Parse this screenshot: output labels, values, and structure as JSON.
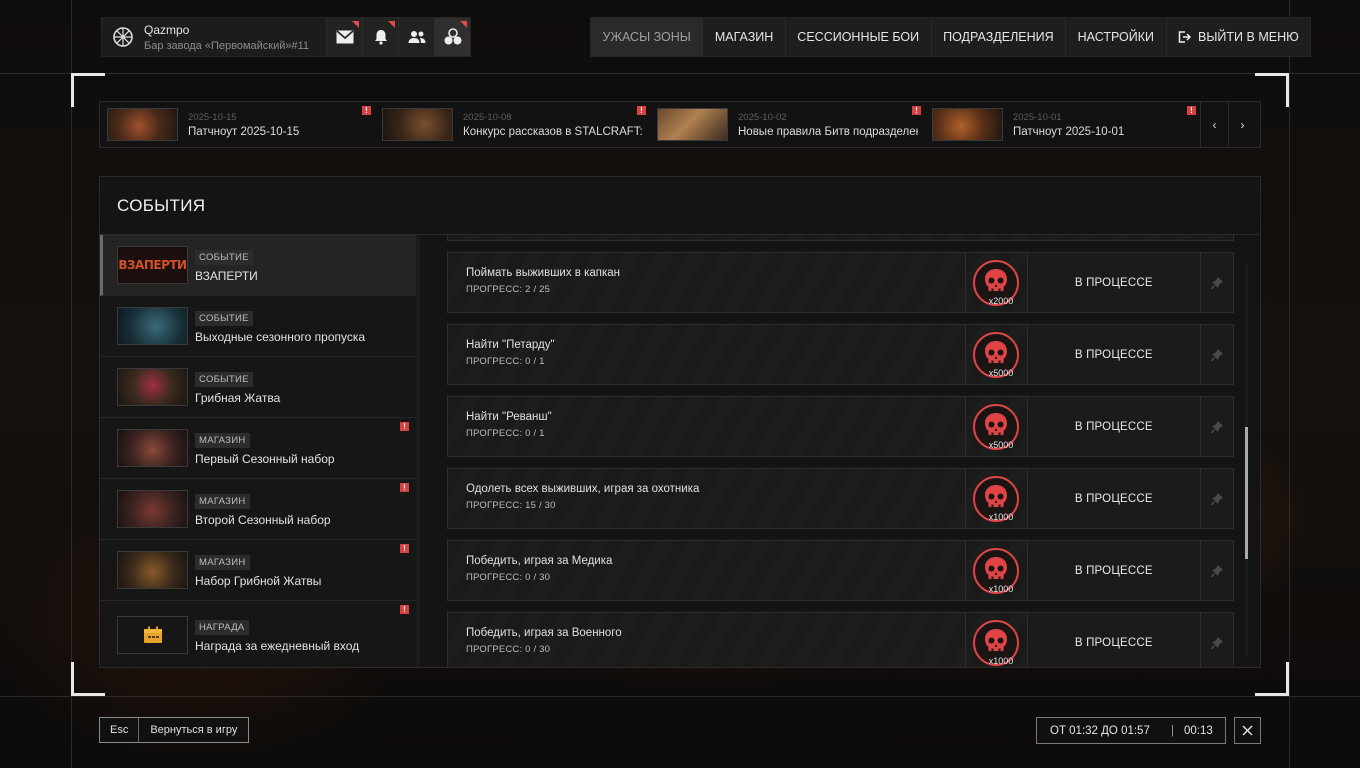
{
  "profile": {
    "nickname": "Qazmpo",
    "location": "Бар завода «Первомайский»#11"
  },
  "header_buttons": [
    {
      "icon": "mail-icon",
      "flag": true
    },
    {
      "icon": "bell-icon",
      "flag": true
    },
    {
      "icon": "friends-icon",
      "flag": false
    },
    {
      "icon": "squad-icon",
      "flag": true,
      "active": true
    }
  ],
  "nav": {
    "items": [
      "УЖАСЫ ЗОНЫ",
      "МАГАЗИН",
      "СЕССИОННЫЕ БОИ",
      "ПОДРАЗДЕЛЕНИЯ",
      "НАСТРОЙКИ"
    ],
    "exit": "ВЫЙТИ В МЕНЮ"
  },
  "news": [
    {
      "date": "2025-10-15",
      "title": "Патчноут 2025-10-15"
    },
    {
      "date": "2025-10-08",
      "title": "Конкурс рассказов в STALCRAFT: X"
    },
    {
      "date": "2025-10-02",
      "title": "Новые правила Битв подразделений"
    },
    {
      "date": "2025-10-01",
      "title": "Патчноут 2025-10-01"
    }
  ],
  "news_arrows": {
    "prev": "‹",
    "next": "›"
  },
  "panel": {
    "title": "СОБЫТИЯ"
  },
  "events": [
    {
      "tag": "СОБЫТИЕ",
      "name": "ВЗАПЕРТИ",
      "thumb_text": "ВЗАПЕРТИ",
      "selected": true,
      "alert": false
    },
    {
      "tag": "СОБЫТИЕ",
      "name": "Выходные сезонного пропуска",
      "selected": false,
      "alert": false
    },
    {
      "tag": "СОБЫТИЕ",
      "name": "Грибная Жатва",
      "selected": false,
      "alert": false
    },
    {
      "tag": "МАГАЗИН",
      "name": "Первый Сезонный набор",
      "selected": false,
      "alert": true
    },
    {
      "tag": "МАГАЗИН",
      "name": "Второй Сезонный набор",
      "selected": false,
      "alert": true
    },
    {
      "tag": "МАГАЗИН",
      "name": "Набор Грибной Жатвы",
      "selected": false,
      "alert": true
    },
    {
      "tag": "НАГРАДА",
      "name": "Награда за ежедневный вход",
      "selected": false,
      "alert": true
    }
  ],
  "tasks": [
    {
      "name": "Поймать выживших в капкан",
      "progress": "ПРОГРЕСС: 2 / 25",
      "reward": "x2000",
      "status": "В ПРОЦЕССЕ"
    },
    {
      "name": "Найти \"Петарду\"",
      "progress": "ПРОГРЕСС: 0 / 1",
      "reward": "x5000",
      "status": "В ПРОЦЕССЕ"
    },
    {
      "name": "Найти \"Реванш\"",
      "progress": "ПРОГРЕСС: 0 / 1",
      "reward": "x5000",
      "status": "В ПРОЦЕССЕ"
    },
    {
      "name": "Одолеть всех выживших, играя за охотника",
      "progress": "ПРОГРЕСС: 15 / 30",
      "reward": "x1000",
      "status": "В ПРОЦЕССЕ"
    },
    {
      "name": "Победить, играя за Медика",
      "progress": "ПРОГРЕСС: 0 / 30",
      "reward": "x1000",
      "status": "В ПРОЦЕССЕ"
    },
    {
      "name": "Победить, играя за Военного",
      "progress": "ПРОГРЕСС: 0 / 30",
      "reward": "x1000",
      "status": "В ПРОЦЕССЕ"
    }
  ],
  "footer": {
    "esc_key": "Esc",
    "return_label": "Вернуться в игру",
    "time_range": "ОТ 01:32 ДО 01:57",
    "time_sep": "|",
    "time_left": "00:13"
  },
  "colors": {
    "accent_red": "#e04545",
    "alert": "#d94040",
    "text": "#e0e0e0"
  }
}
